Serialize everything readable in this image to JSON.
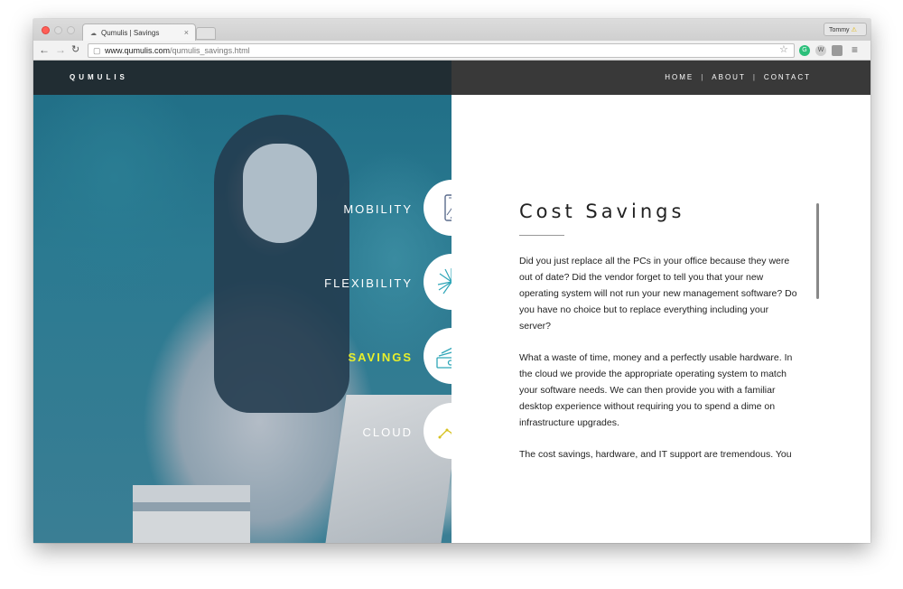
{
  "browser": {
    "tab_title": "Qumulis | Savings",
    "profile_name": "Tommy",
    "url_host": "www.qumulis.com",
    "url_path": "/qumulis_savings.html"
  },
  "site": {
    "logo": "QUMULIS",
    "nav": [
      "HOME",
      "ABOUT",
      "CONTACT"
    ]
  },
  "features": [
    {
      "label": "MOBILITY",
      "icon": "phone-icon",
      "active": false
    },
    {
      "label": "FLEXIBILITY",
      "icon": "burst-icon",
      "active": false
    },
    {
      "label": "SAVINGS",
      "icon": "money-icon",
      "active": true
    },
    {
      "label": "CLOUD",
      "icon": "chart-line-icon",
      "active": false
    }
  ],
  "content": {
    "title": "Cost Savings",
    "paragraphs": [
      "Did you just replace all the PCs in your office because they were out of date? Did the vendor forget to tell you that your new operating system will not run your new management software? Do you have no choice but to replace everything including your server?",
      "What a waste of time, money and a perfectly usable hardware. In the cloud we provide the appropriate operating system to match your software needs. We can then provide you with a familiar desktop experience without requiring you to spend a dime on infrastructure upgrades.",
      "The cost savings, hardware, and IT support are tremendous. You"
    ]
  },
  "colors": {
    "accent_active": "#e7ef2c",
    "icon_stroke": "#2fa6b8",
    "topbar": "#2a2a2a"
  }
}
